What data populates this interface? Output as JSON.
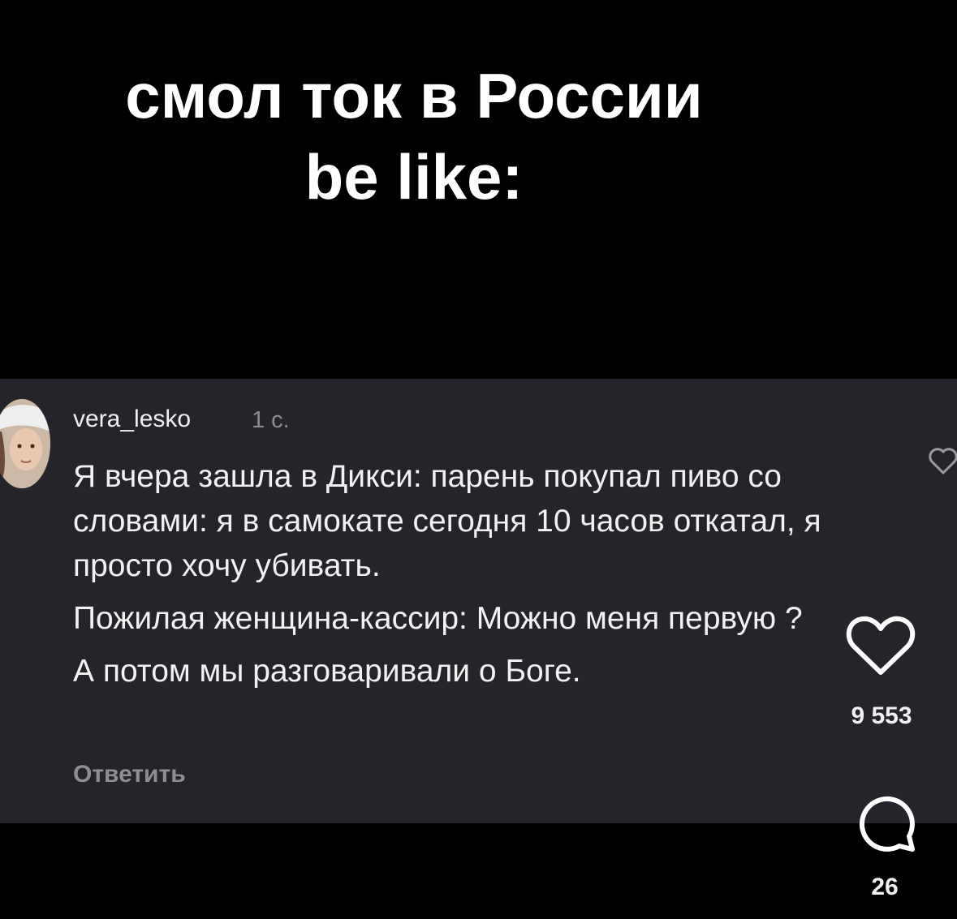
{
  "meme": {
    "title_line1": "смол ток в России",
    "title_line2": "be like:"
  },
  "comment": {
    "username": "vera_lesko",
    "timestamp": "1 с.",
    "paragraphs": [
      "Я вчера зашла в Дикси: парень покупал пиво со словами: я в самокате сегодня 10 часов откатал, я просто хочу убивать.",
      "Пожилая женщина-кассир: Можно меня первую ?",
      "А потом мы разговаривали о Боге."
    ],
    "reply_label": "Ответить"
  },
  "actions": {
    "like_icon": "heart-icon",
    "like_count": "9 553",
    "comment_icon": "comment-bubble-icon",
    "comment_count": "26"
  },
  "colors": {
    "background": "#000000",
    "card": "#24242a",
    "text": "#f2f2f2",
    "muted": "#8c8c93"
  }
}
